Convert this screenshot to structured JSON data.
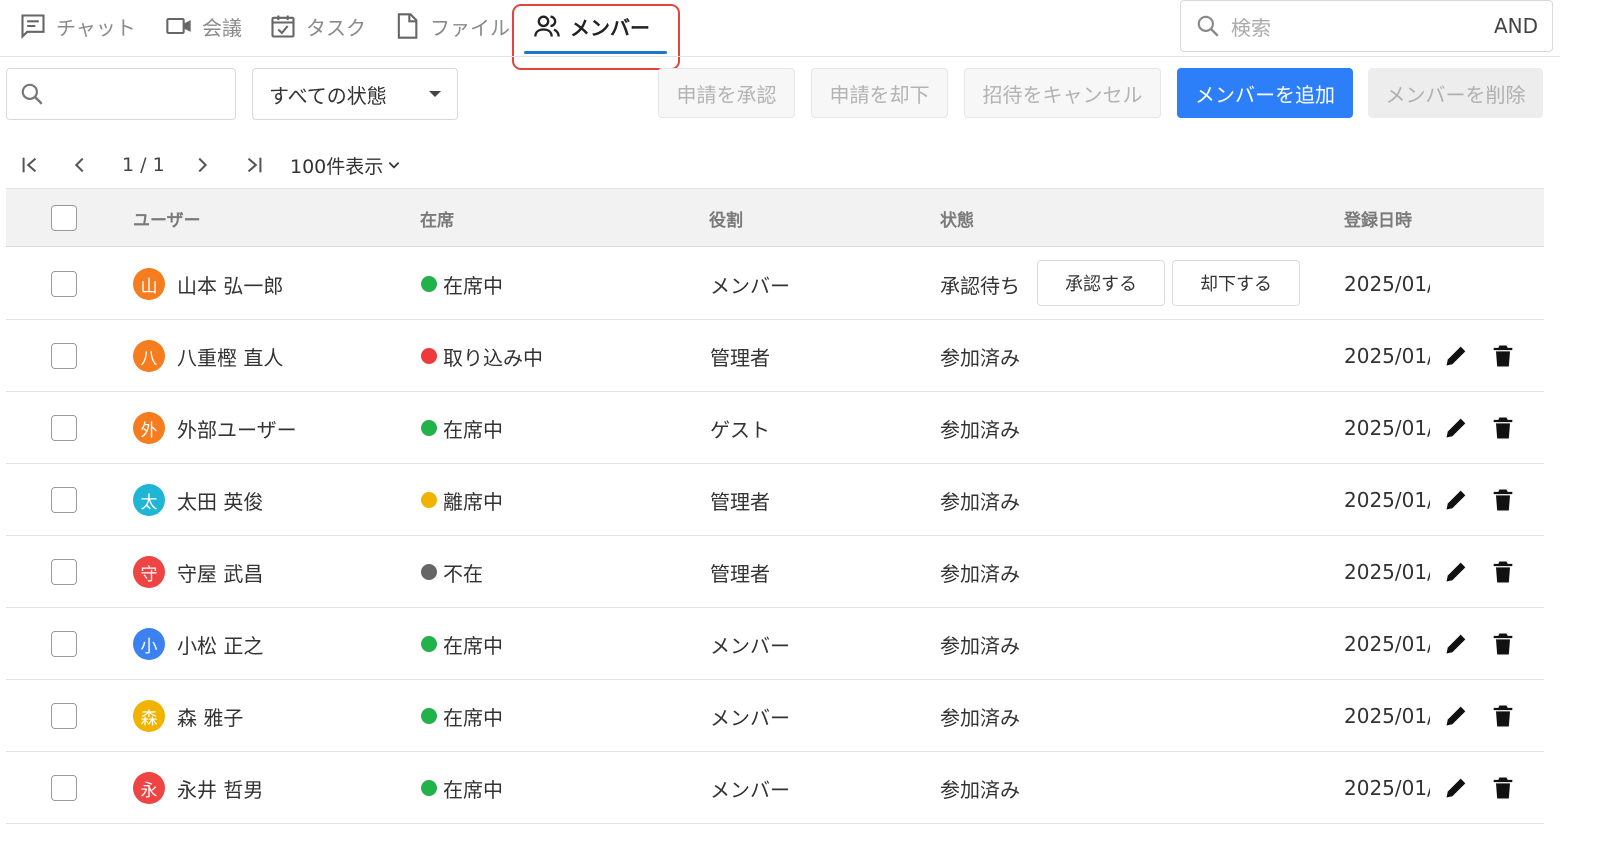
{
  "tabs": [
    {
      "label": "チャット",
      "icon": "chat-icon",
      "active": false
    },
    {
      "label": "会議",
      "icon": "video-icon",
      "active": false
    },
    {
      "label": "タスク",
      "icon": "task-calendar-icon",
      "active": false
    },
    {
      "label": "ファイル",
      "icon": "file-icon",
      "active": false
    },
    {
      "label": "メンバー",
      "icon": "members-icon",
      "active": true
    }
  ],
  "global_search": {
    "placeholder": "検索",
    "mode": "AND"
  },
  "toolbar": {
    "search_value": "",
    "status_filter": "すべての状態",
    "approve_label": "申請を承認",
    "reject_label": "申請を却下",
    "cancel_invite_label": "招待をキャンセル",
    "add_member_label": "メンバーを追加",
    "remove_member_label": "メンバーを削除"
  },
  "pagination": {
    "page_info": "1 / 1",
    "page_size": "100件表示"
  },
  "table": {
    "headers": {
      "user": "ユーザー",
      "presence": "在席",
      "role": "役割",
      "status": "状態",
      "registered": "登録日時"
    },
    "rows": [
      {
        "initial": "山",
        "name": "山本 弘一郎",
        "avatar_color": "#f57c1f",
        "presence": "在席中",
        "presence_color": "#22b24c",
        "role": "メンバー",
        "status": "承認待ち",
        "date": "2025/01/",
        "approve": "承認する",
        "reject": "却下する"
      },
      {
        "initial": "八",
        "name": "八重樫 直人",
        "avatar_color": "#f57c1f",
        "presence": "取り込み中",
        "presence_color": "#ee3a3a",
        "role": "管理者",
        "status": "参加済み",
        "date": "2025/01/"
      },
      {
        "initial": "外",
        "name": "外部ユーザー",
        "avatar_color": "#f57c1f",
        "presence": "在席中",
        "presence_color": "#22b24c",
        "role": "ゲスト",
        "status": "参加済み",
        "date": "2025/01/"
      },
      {
        "initial": "太",
        "name": "太田 英俊",
        "avatar_color": "#1fb6d6",
        "presence": "離席中",
        "presence_color": "#f0b400",
        "role": "管理者",
        "status": "参加済み",
        "date": "2025/01/"
      },
      {
        "initial": "守",
        "name": "守屋 武昌",
        "avatar_color": "#ee4444",
        "presence": "不在",
        "presence_color": "#666666",
        "role": "管理者",
        "status": "参加済み",
        "date": "2025/01/"
      },
      {
        "initial": "小",
        "name": "小松 正之",
        "avatar_color": "#3b82f0",
        "presence": "在席中",
        "presence_color": "#22b24c",
        "role": "メンバー",
        "status": "参加済み",
        "date": "2025/01/"
      },
      {
        "initial": "森",
        "name": "森 雅子",
        "avatar_color": "#f0b400",
        "presence": "在席中",
        "presence_color": "#22b24c",
        "role": "メンバー",
        "status": "参加済み",
        "date": "2025/01/"
      },
      {
        "initial": "永",
        "name": "永井 哲男",
        "avatar_color": "#ee4444",
        "presence": "在席中",
        "presence_color": "#22b24c",
        "role": "メンバー",
        "status": "参加済み",
        "date": "2025/01/"
      }
    ]
  },
  "colors": {
    "primary": "#2d7ff9",
    "tab_underline": "#1e78c8",
    "highlight": "#e0463e"
  }
}
